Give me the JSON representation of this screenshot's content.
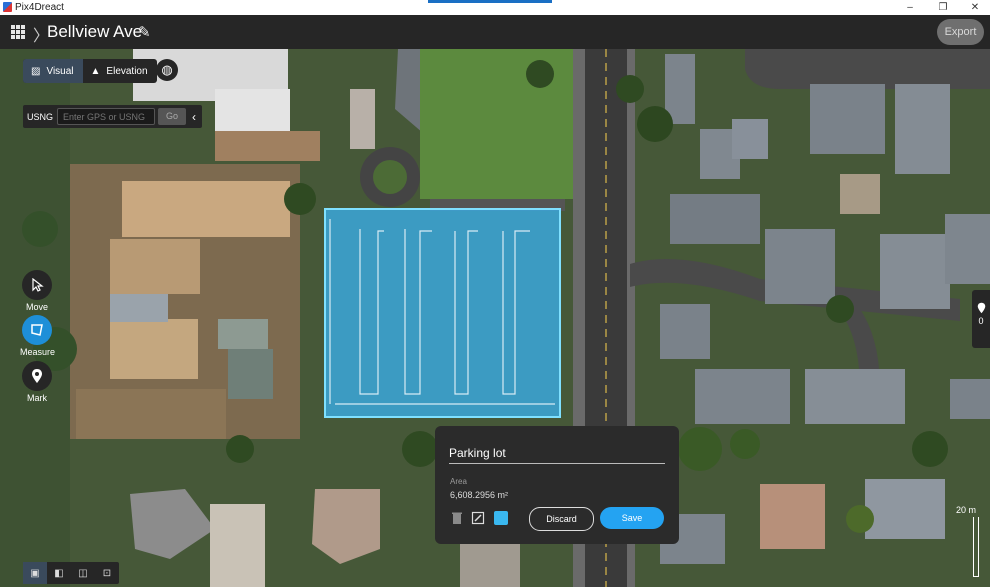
{
  "window": {
    "app_title": "Pix4Dreact",
    "min": "–",
    "max": "❐",
    "close": "✕"
  },
  "header": {
    "project_title": "Bellview Ave",
    "export_label": "Export"
  },
  "view_toggle": {
    "visual_label": "Visual",
    "elevation_label": "Elevation",
    "selected": "Visual"
  },
  "search": {
    "label": "USNG",
    "placeholder": "Enter GPS or USNG",
    "go_label": "Go"
  },
  "tools": {
    "move_label": "Move",
    "measure_label": "Measure",
    "mark_label": "Mark",
    "active": "Measure"
  },
  "markers": {
    "count": "0"
  },
  "scale": {
    "label": "20 m"
  },
  "measure_panel": {
    "name_value": "Parking lot",
    "area_label": "Area",
    "area_value": "6,608.2956 m²",
    "color": "#3ab8f0",
    "discard_label": "Discard",
    "save_label": "Save"
  },
  "colors": {
    "accent": "#24a3f2",
    "selection_fill": "#3aa9e0",
    "toolbar": "#262626"
  }
}
